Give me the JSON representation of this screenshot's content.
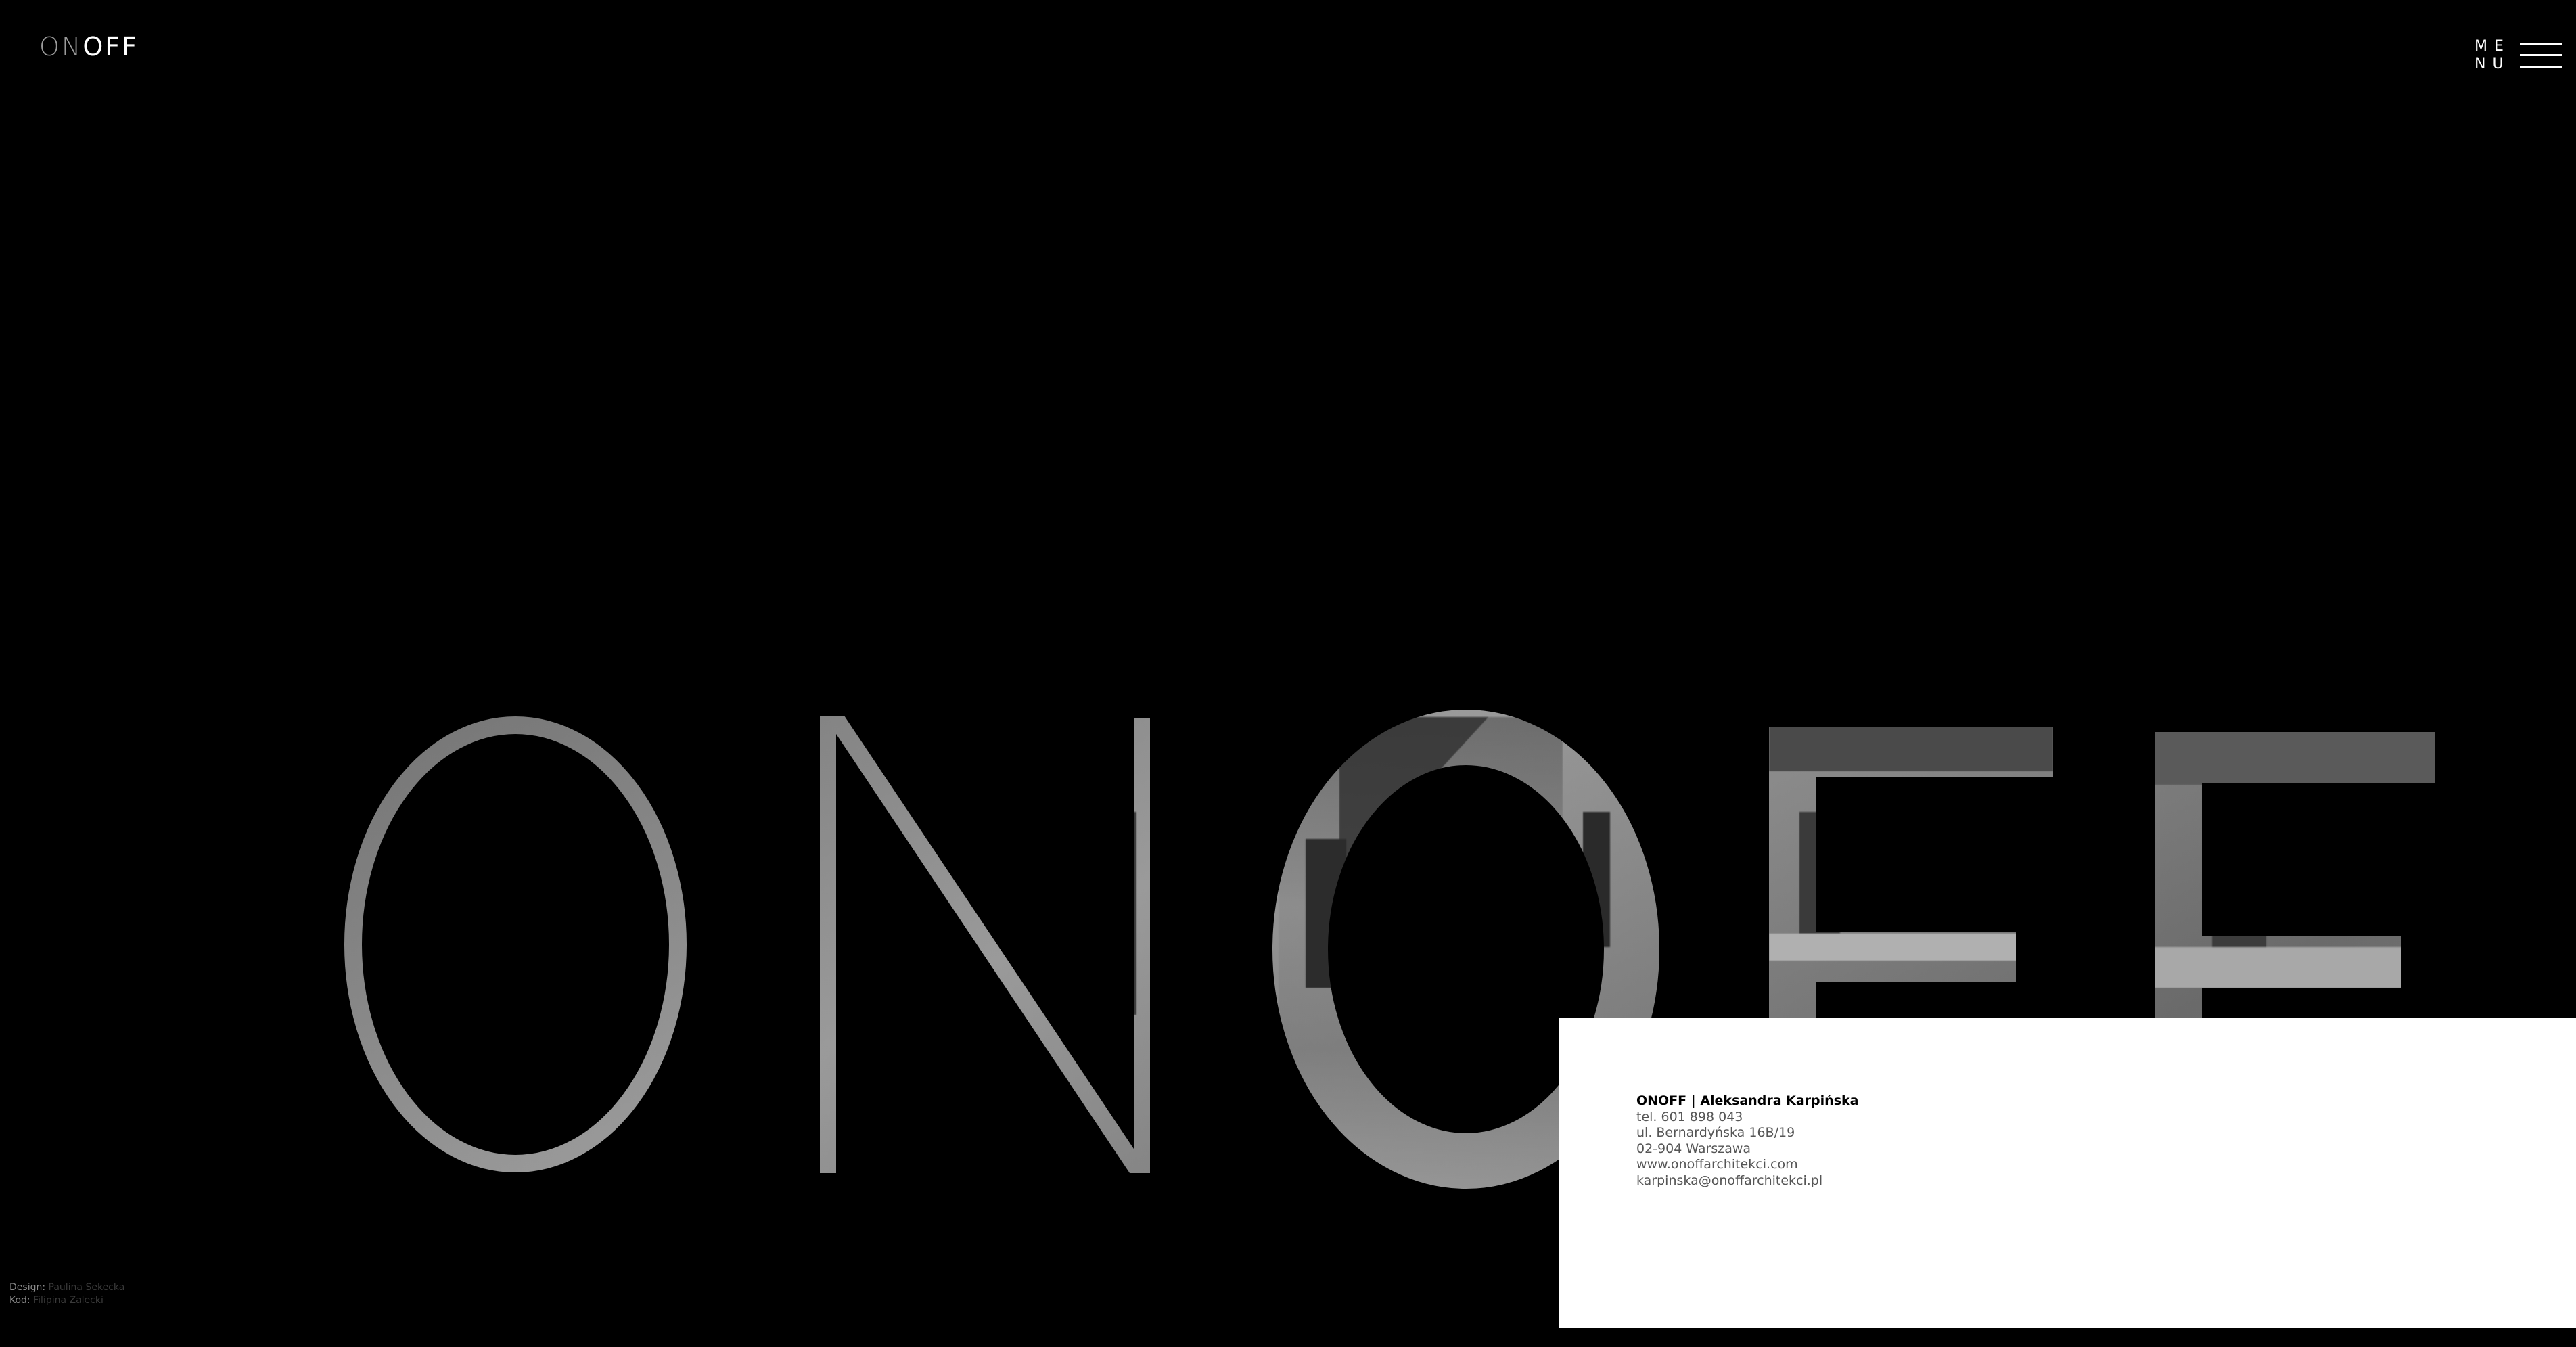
{
  "header": {
    "logo_on": "ON",
    "logo_off": "OFF",
    "menu_line1": "ME",
    "menu_line2": "NU"
  },
  "hero": {
    "wordmark": "ONOFF"
  },
  "contact": {
    "company": "ONOFF | Aleksandra Karpińska",
    "phone": "tel. 601 898 043",
    "street": "ul. Bernardyńska 16B/19",
    "city": "02-904 Warszawa",
    "website": "www.onoffarchitekci.com",
    "email": "karpinska@onoffarchitekci.pl"
  },
  "credits": {
    "design_label": "Design:",
    "design_name": "Paulina Sekecka",
    "code_label": "Kod:",
    "code_name": "Filipina Zalecki"
  },
  "colors": {
    "background": "#000000",
    "card": "#ffffff",
    "logo_on": "#9a9a9a"
  }
}
